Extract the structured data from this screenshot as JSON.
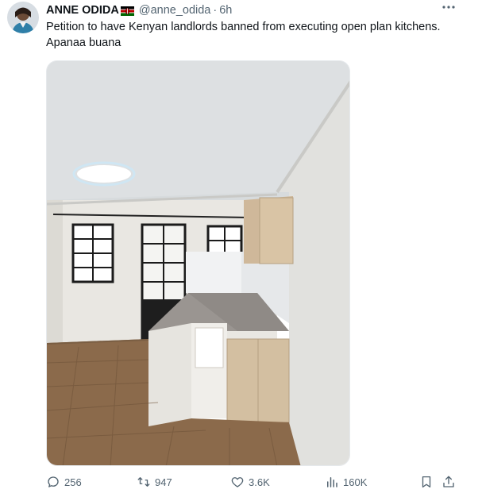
{
  "tweet": {
    "author_name": "ANNE ODIDA",
    "author_handle": "@anne_odida",
    "separator": "·",
    "time": "6h",
    "text": "Petition to have Kenyan landlords banned from executing open plan kitchens. Apanaa buana",
    "flag_icon": "kenya-flag-icon",
    "more_icon": "more-options-icon"
  },
  "actions": {
    "replies": "256",
    "reposts": "947",
    "likes": "3.6K",
    "views": "160K"
  },
  "colors": {
    "text_primary": "#0f1419",
    "text_secondary": "#536471"
  }
}
